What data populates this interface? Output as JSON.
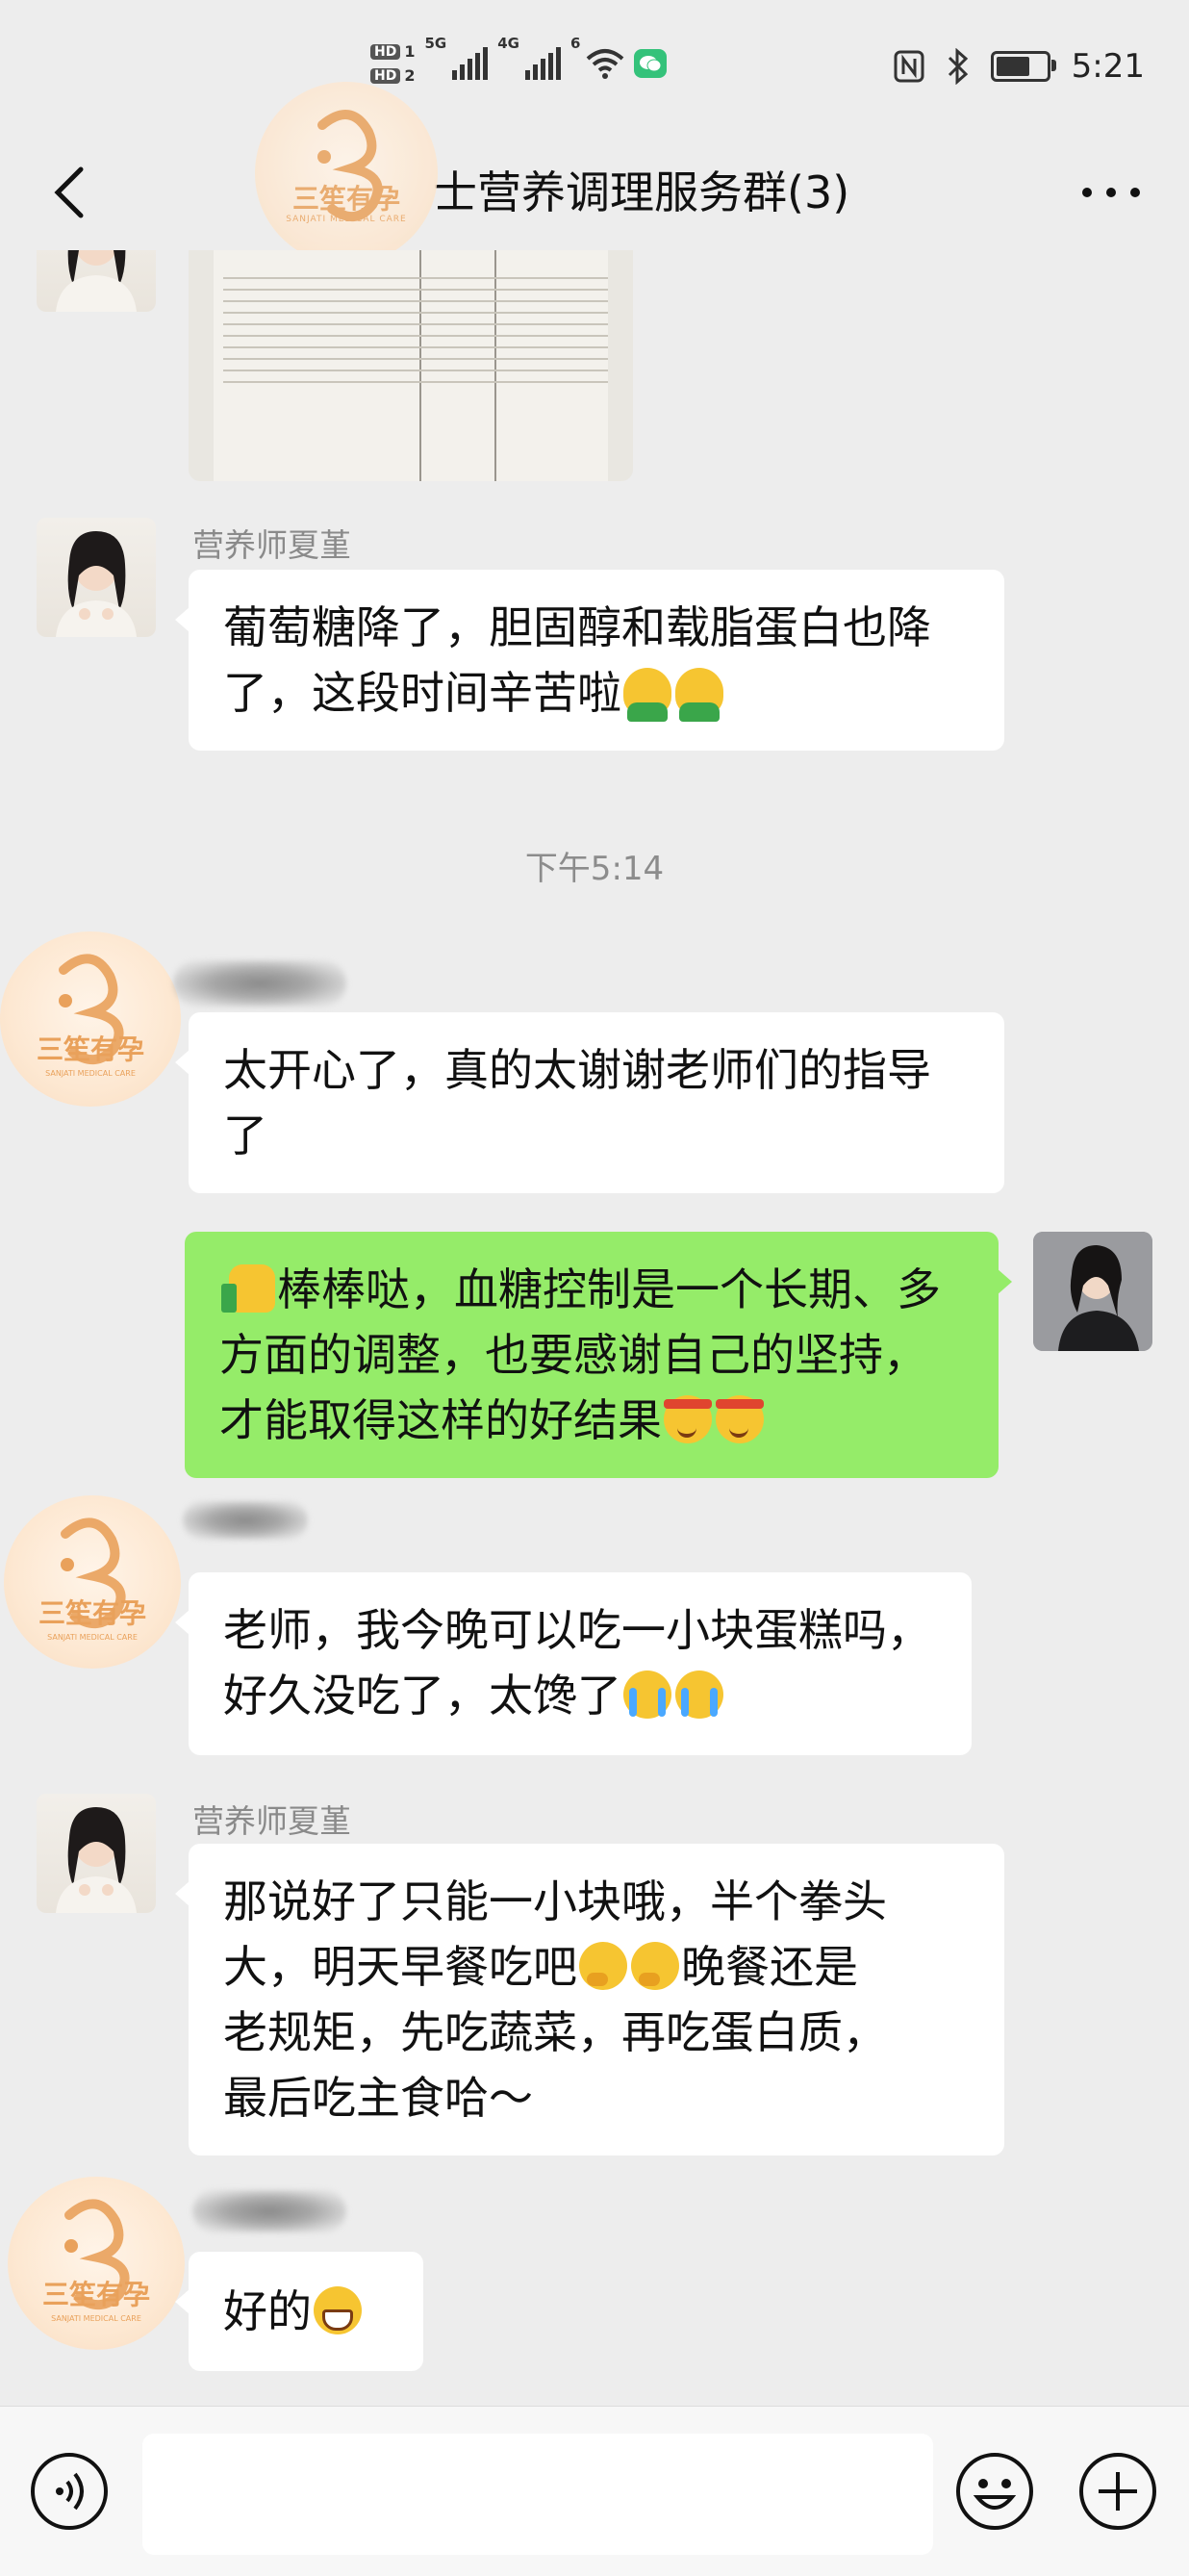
{
  "status_bar": {
    "hd1": "HD",
    "hd1_num": "1",
    "hd2": "HD",
    "hd2_num": "2",
    "net1": "5G",
    "net2": "4G",
    "wifi_num": "6",
    "time": "5:21"
  },
  "header": {
    "title": "士营养调理服务群(3)"
  },
  "logo": {
    "brand": "三笙有孕",
    "brand_en": "SANJATI MEDICAL CARE"
  },
  "messages": [
    {
      "id": "m1",
      "sender": "营养师夏堇",
      "text": "葡萄糖降了，胆固醇和载脂蛋白也降了，这段时间辛苦啦"
    },
    {
      "id": "ts",
      "text": "下午5:14"
    },
    {
      "id": "m2",
      "text": "太开心了，真的太谢谢老师们的指导了"
    },
    {
      "id": "m3",
      "mine": true,
      "text": "棒棒哒，血糖控制是一个长期、多方面的调整，也要感谢自己的坚持，才能取得这样的好结果"
    },
    {
      "id": "m4",
      "text": "老师，我今晚可以吃一小块蛋糕吗，好久没吃了，太馋了"
    },
    {
      "id": "m5",
      "sender": "营养师夏堇",
      "text_line1": "那说好了只能一小块哦，半个拳头",
      "text_line2a": "大，明天早餐吃吧",
      "text_line2b": "晚餐还是",
      "text_line3": "老规矩，先吃蔬菜，再吃蛋白质，",
      "text_line4": "最后吃主食哈～"
    },
    {
      "id": "m6",
      "text": "好的"
    }
  ],
  "colors": {
    "background": "#ededed",
    "bubble_other": "#ffffff",
    "bubble_mine": "#95ec69",
    "logo_orange": "#e9a15b"
  }
}
